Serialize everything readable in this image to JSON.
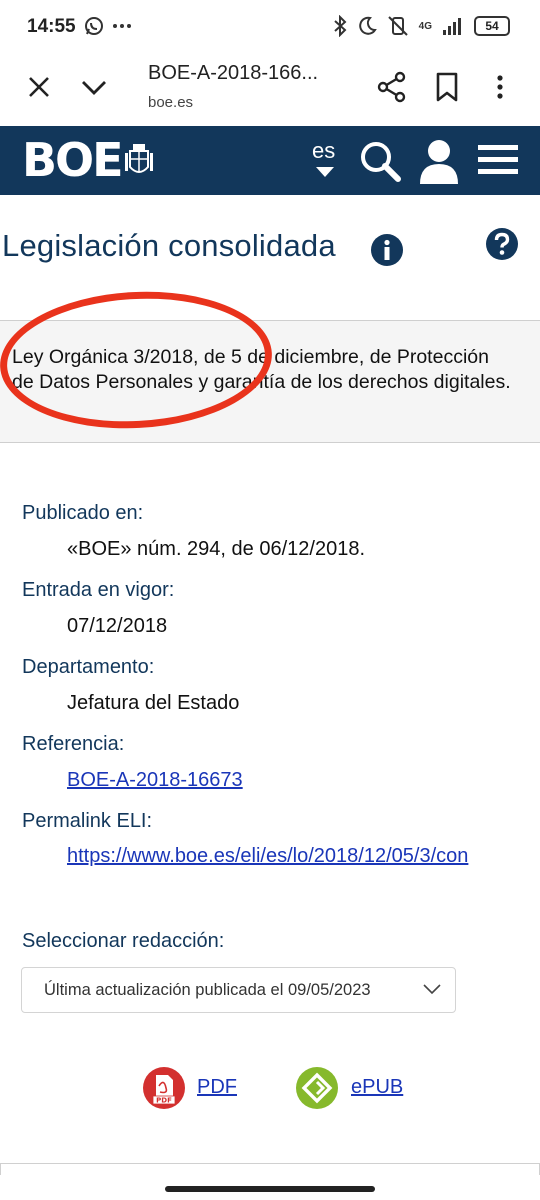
{
  "status_bar": {
    "time": "14:55",
    "left_icons": [
      "whatsapp-icon",
      "more-dots-icon"
    ],
    "right_icons": [
      "bluetooth-icon",
      "moon-icon",
      "mute-icon",
      "signal-4g-icon"
    ],
    "network": "4G",
    "battery": "54"
  },
  "browser": {
    "title": "BOE-A-2018-166...",
    "domain": "boe.es"
  },
  "header": {
    "logo": "BOE",
    "language": "es",
    "background": "#12375b"
  },
  "page": {
    "title": "Legislación consolidada"
  },
  "law": {
    "title": "Ley Orgánica 3/2018, de 5 de diciembre, de Protección de Datos Personales y garantía de los derechos digitales.",
    "highlight_color": "#e9331c"
  },
  "meta": {
    "published_label": "Publicado en:",
    "published_value": "«BOE» núm. 294, de 06/12/2018.",
    "entry_label": "Entrada en vigor:",
    "entry_value": "07/12/2018",
    "department_label": "Departamento:",
    "department_value": "Jefatura del Estado",
    "reference_label": "Referencia:",
    "reference_value": "BOE-A-2018-16673",
    "permalink_label": "Permalink ELI:",
    "permalink_value": "https://www.boe.es/eli/es/lo/2018/12/05/3/con"
  },
  "redaction": {
    "label": "Seleccionar redacción:",
    "selected": "Última actualización publicada el 09/05/2023"
  },
  "downloads": {
    "pdf_label": "PDF",
    "pdf_badge": "PDF",
    "epub_label": "ePUB",
    "pdf_color": "#d3302f",
    "epub_color": "#86b92c"
  }
}
